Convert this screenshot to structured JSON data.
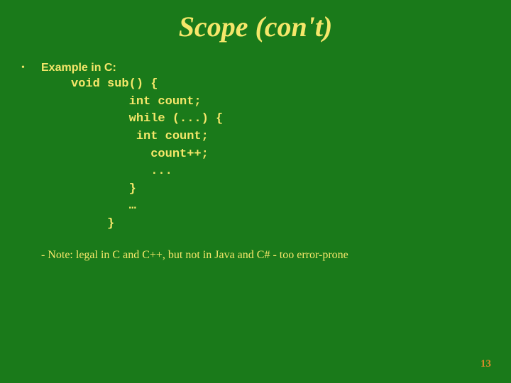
{
  "title": "Scope (con't)",
  "bullet": {
    "marker": "•",
    "label": "Example in C:"
  },
  "code": {
    "l1": "void sub() {",
    "l2": "        int count;",
    "l3": "        while (...) {",
    "l4": "         int count;",
    "l5": "           count++;",
    "l6": "           ...",
    "l7": "        }",
    "l8": "        …",
    "l9": "     }"
  },
  "note": "- Note: legal in C and C++, but not in Java and C# - too error-prone",
  "page_number": "13"
}
